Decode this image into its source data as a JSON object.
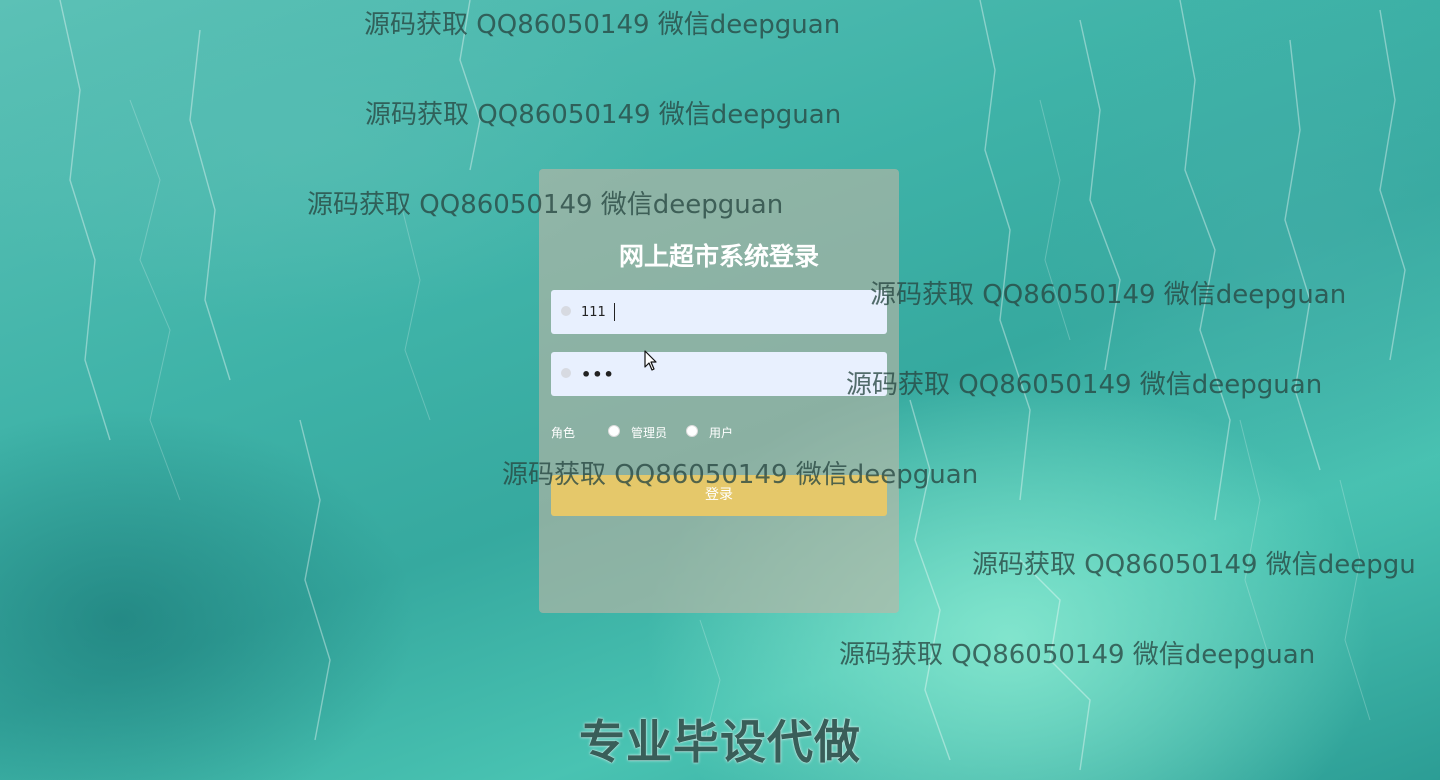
{
  "watermarks": [
    "源码获取 QQ86050149 微信deepguan",
    "源码获取 QQ86050149 微信deepguan",
    "源码获取 QQ86050149 微信deepguan",
    "源码获取 QQ86050149 微信deepguan",
    "源码获取 QQ86050149 微信deepguan",
    "源码获取 QQ86050149 微信deepguan",
    "源码获取 QQ86050149 微信deepgu",
    "源码获取 QQ86050149 微信deepguan"
  ],
  "bottom_watermark": "专业毕设代做",
  "login": {
    "title": "网上超市系统登录",
    "username_value": "111",
    "password_value": "•••",
    "role_label": "角色",
    "role_options": [
      "管理员",
      "用户"
    ],
    "submit_label": "登录",
    "button_color": "#e5c86a"
  }
}
